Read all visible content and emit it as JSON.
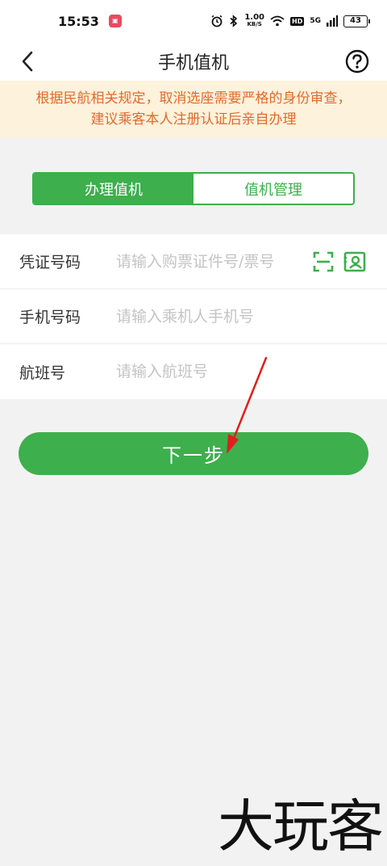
{
  "status_bar": {
    "time": "15:53",
    "net_speed_value": "1.00",
    "net_speed_unit": "KB/S",
    "hd_badge": "HD",
    "network_type": "5G",
    "battery_level": "43"
  },
  "nav": {
    "title": "手机值机",
    "back_icon": "chevron-left-icon",
    "help_icon": "question-circle-icon"
  },
  "notice": {
    "line1": "根据民航相关规定，取消选座需要严格的身份审查，",
    "line2": "建议乘客本人注册认证后亲自办理"
  },
  "tabs": [
    {
      "label": "办理值机",
      "active": true
    },
    {
      "label": "值机管理",
      "active": false
    }
  ],
  "form": {
    "ticket": {
      "label": "凭证号码",
      "placeholder": "请输入购票证件号/票号",
      "value": ""
    },
    "phone": {
      "label": "手机号码",
      "placeholder": "请输入乘机人手机号",
      "value": ""
    },
    "flight": {
      "label": "航班号",
      "placeholder": "请输入航班号",
      "value": ""
    }
  },
  "next_button": {
    "label": "下一步"
  },
  "watermark": "大玩客",
  "colors": {
    "primary_green": "#3daf4c",
    "notice_bg": "#fdf2dc",
    "notice_text": "#e26a2c",
    "annotation_arrow": "#e01e1e"
  }
}
